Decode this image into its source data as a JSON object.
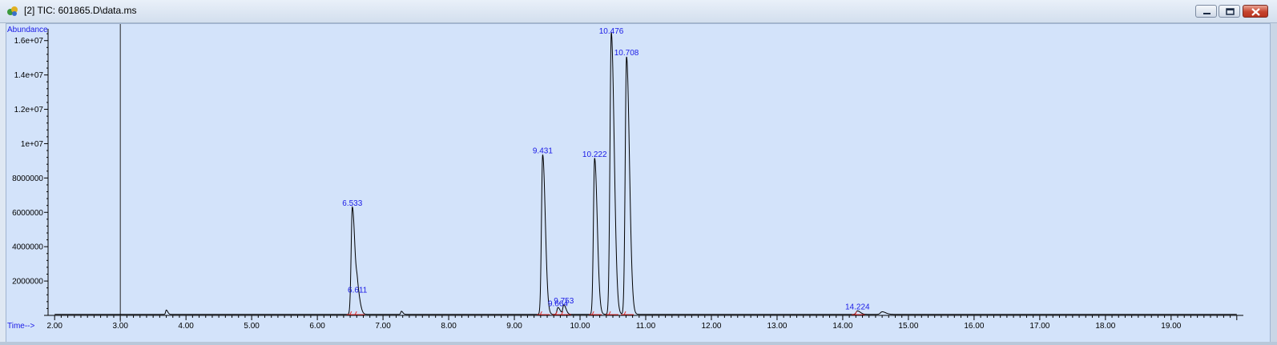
{
  "window": {
    "title": "[2] TIC: 601865.D\\data.ms",
    "icons": {
      "app": "chromatogram-app-icon",
      "minimize": "minimize-icon",
      "maximize": "maximize-icon",
      "close": "close-icon"
    }
  },
  "colors": {
    "plot_bg": "#d3e3fa",
    "trace": "#000000",
    "peak_label": "#1a1ae6",
    "baseline_marks": "#e03030",
    "axis_label": "#1a1ae6"
  },
  "chart_data": {
    "type": "line",
    "ylabel": "Abundance",
    "xlabel": "Time-->",
    "xlim": [
      1.9,
      20.1
    ],
    "ylim": [
      0,
      16500000
    ],
    "x_ticks": [
      "2.00",
      "3.00",
      "4.00",
      "5.00",
      "6.00",
      "7.00",
      "8.00",
      "9.00",
      "10.00",
      "11.00",
      "12.00",
      "13.00",
      "14.00",
      "15.00",
      "16.00",
      "17.00",
      "18.00",
      "19.00"
    ],
    "x_tick_values": [
      2,
      3,
      4,
      5,
      6,
      7,
      8,
      9,
      10,
      11,
      12,
      13,
      14,
      15,
      16,
      17,
      18,
      19
    ],
    "y_ticks": [
      "2000000",
      "4000000",
      "6000000",
      "8000000",
      "1e+07",
      "1.2e+07",
      "1.4e+07",
      "1.6e+07"
    ],
    "y_tick_values": [
      2000000,
      4000000,
      6000000,
      8000000,
      10000000,
      12000000,
      14000000,
      16000000
    ],
    "cursor_time": 3.0,
    "peaks": [
      {
        "label": "6.533",
        "rt": 6.533,
        "height": 6250000,
        "width": 0.018
      },
      {
        "label": "6.611",
        "rt": 6.611,
        "height": 1200000,
        "width": 0.018
      },
      {
        "label": "9.431",
        "rt": 9.431,
        "height": 9300000,
        "width": 0.018
      },
      {
        "label": "9.664",
        "rt": 9.664,
        "height": 400000,
        "width": 0.015
      },
      {
        "label": "9.753",
        "rt": 9.753,
        "height": 550000,
        "width": 0.015
      },
      {
        "label": "10.222",
        "rt": 10.222,
        "height": 9100000,
        "width": 0.018
      },
      {
        "label": "10.476",
        "rt": 10.476,
        "height": 16400000,
        "width": 0.02
      },
      {
        "label": "10.708",
        "rt": 10.708,
        "height": 15000000,
        "width": 0.02
      },
      {
        "label": "14.224",
        "rt": 14.224,
        "height": 200000,
        "width": 0.02
      }
    ],
    "minor_peaks": [
      {
        "rt": 3.7,
        "height": 250000,
        "width": 0.01
      },
      {
        "rt": 7.28,
        "height": 180000,
        "width": 0.01
      },
      {
        "rt": 14.6,
        "height": 150000,
        "width": 0.025
      }
    ]
  }
}
